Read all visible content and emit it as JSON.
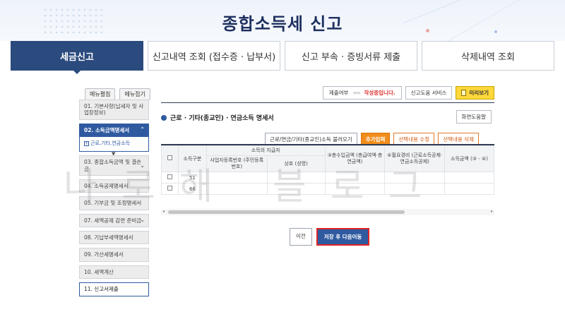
{
  "header": {
    "title": "종합소득세 신고"
  },
  "tabs": [
    {
      "label": "세금신고",
      "active": true
    },
    {
      "label": "신고내역 조회 (접수증 · 납부서)"
    },
    {
      "label": "신고 부속 · 증빙서류 제출"
    },
    {
      "label": "삭제내역 조회"
    }
  ],
  "sidebar": {
    "expand_label": "메뉴펼침",
    "collapse_label": "메뉴접기",
    "items": [
      {
        "label": "01. 기본사항(납세자 및 사업장정보)"
      },
      {
        "label": "02. 소득금액명세서",
        "expanded": true,
        "sub": "근로,기타,연금소득"
      },
      {
        "label": "03. 종합소득금액 및 결손금"
      },
      {
        "label": "04. 소득공제명세서"
      },
      {
        "label": "05. 기부금 및 조정명세서"
      },
      {
        "label": "07. 세액공제 감면 준비금"
      },
      {
        "label": "08. 기납부세액명세서"
      },
      {
        "label": "09. 가산세명세서"
      },
      {
        "label": "10. 세액계산"
      },
      {
        "label": "11. 신고서제출"
      }
    ]
  },
  "toolbar": {
    "status_label": "제출여부",
    "status_arrows": "›››››",
    "status_value": "작성중입니다.",
    "guide_button": "신고도움 서비스",
    "preview_button": "미리보기"
  },
  "section": {
    "title": "근로 · 기타(종교인) · 연금소득 명세서",
    "help_button": "화면도움말"
  },
  "actions": {
    "load": "근로/연금/기타(종교인)소득 불러오기",
    "add": "추가입력",
    "edit": "선택내용 수정",
    "delete": "선택내용 삭제"
  },
  "table": {
    "group_header": "소득의 지급자",
    "col_income_type": "소득구분",
    "col_biz_no": "사업자등록번호 (주민등록번호)",
    "col_name": "상호 (성명)",
    "col_total_income": "③총수입금액 (총급여액·총연금액)",
    "col_expense": "④필요경비 (근로소득공제· 연금소득공제)",
    "col_income_amount": "소득금액 (③ - ④)",
    "rows": [
      {
        "type": "51"
      },
      {
        "type": "66"
      }
    ]
  },
  "buttons": {
    "prev": "이전",
    "next": "저장 후 다음이동"
  },
  "watermark": "나로해 블로그"
}
